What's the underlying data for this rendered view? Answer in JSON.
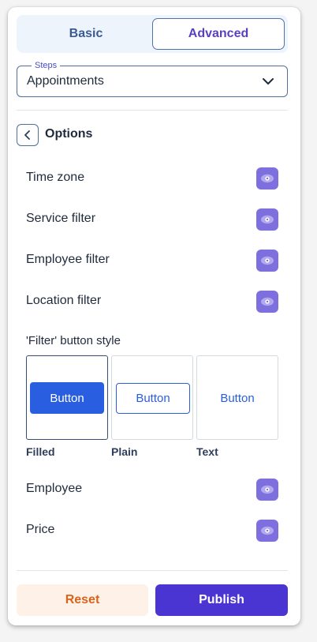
{
  "tabs": {
    "basic": "Basic",
    "advanced": "Advanced",
    "active": "Advanced"
  },
  "steps": {
    "legend": "Steps",
    "value": "Appointments",
    "icon": "chevron-down-icon"
  },
  "options": {
    "title": "Options",
    "back_icon": "chevron-left-icon",
    "toggles": [
      {
        "label": "Time zone",
        "icon": "eye-icon",
        "visible": true
      },
      {
        "label": "Service filter",
        "icon": "eye-icon",
        "visible": true
      },
      {
        "label": "Employee filter",
        "icon": "eye-icon",
        "visible": true
      },
      {
        "label": "Location filter",
        "icon": "eye-icon",
        "visible": true
      }
    ],
    "filter_style": {
      "heading": "'Filter' button style",
      "choices": [
        {
          "name": "Filled",
          "sample": "Button",
          "selected": true
        },
        {
          "name": "Plain",
          "sample": "Button",
          "selected": false
        },
        {
          "name": "Text",
          "sample": "Button",
          "selected": false
        }
      ]
    },
    "toggles_after": [
      {
        "label": "Employee",
        "icon": "eye-icon",
        "visible": true
      },
      {
        "label": "Price",
        "icon": "eye-icon",
        "visible": true
      }
    ]
  },
  "footer": {
    "reset": "Reset",
    "publish": "Publish"
  },
  "colors": {
    "accent": "#4a35d2",
    "toggle": "#7d6fdd",
    "button_blue": "#2a5ee0",
    "reset_text": "#d9641c",
    "reset_bg": "#fdf1e8"
  }
}
